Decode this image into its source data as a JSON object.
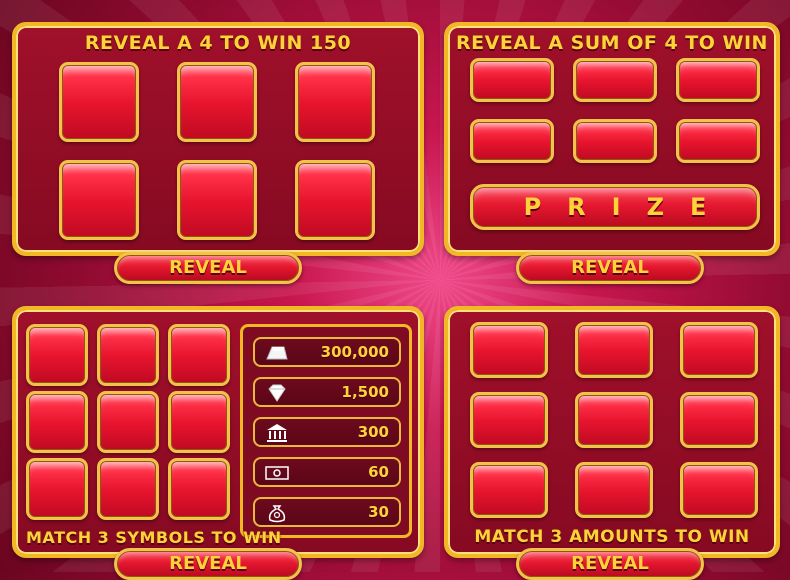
{
  "panels": {
    "top_left": {
      "title": "REVEAL A 4 TO WIN 150",
      "button": "REVEAL"
    },
    "top_right": {
      "title": "REVEAL A SUM OF 4 TO WIN",
      "prize": "PRIZE",
      "button": "REVEAL"
    },
    "bottom_left": {
      "footer": "MATCH 3 SYMBOLS TO WIN",
      "button": "REVEAL",
      "paytable": [
        {
          "icon": "gold-bar-icon",
          "value": "300,000"
        },
        {
          "icon": "diamond-icon",
          "value": "1,500"
        },
        {
          "icon": "bank-icon",
          "value": "300"
        },
        {
          "icon": "banknote-icon",
          "value": "60"
        },
        {
          "icon": "money-bag-icon",
          "value": "30"
        }
      ]
    },
    "bottom_right": {
      "footer": "MATCH 3 AMOUNTS TO WIN",
      "button": "REVEAL"
    }
  },
  "colors": {
    "gold": "#f2b724",
    "panel_red": "#a0102a",
    "tile_red": "#e8142e",
    "text_yellow": "#ffd23a"
  }
}
